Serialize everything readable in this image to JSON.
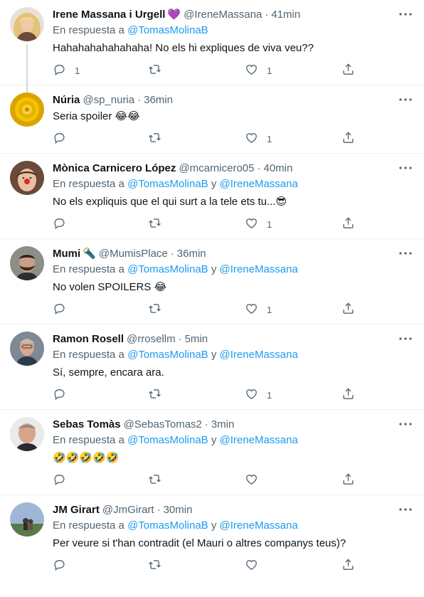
{
  "tweets": [
    {
      "name": "Irene Massana i Urgell",
      "badge": "💜",
      "handle": "@IreneMassana",
      "time": "41min",
      "reply_prefix": "En respuesta a",
      "mentions": [
        "@TomasMolinaB"
      ],
      "text": "Hahahahahahahaha! No els hi expliques de viva veu??",
      "replies": "1",
      "retweets": "",
      "likes": "1",
      "avatar": "irene"
    },
    {
      "name": "Núria",
      "badge": "",
      "handle": "@sp_nuria",
      "time": "36min",
      "reply_prefix": "",
      "mentions": [],
      "text": "Seria spoiler 😂😂",
      "replies": "",
      "retweets": "",
      "likes": "1",
      "avatar": "nuria"
    },
    {
      "name": "Mònica Carnicero López",
      "badge": "",
      "handle": "@mcarnicero05",
      "time": "40min",
      "reply_prefix": "En respuesta a",
      "mentions": [
        "@TomasMolinaB",
        "@IreneMassana"
      ],
      "text": "No els expliquis que el qui surt a la tele ets tu...😎",
      "replies": "",
      "retweets": "",
      "likes": "1",
      "avatar": "monica"
    },
    {
      "name": "Mumi",
      "badge": "🔦",
      "handle": "@MumisPlace",
      "time": "36min",
      "reply_prefix": "En respuesta a",
      "mentions": [
        "@TomasMolinaB",
        "@IreneMassana"
      ],
      "text": "No volen SPOILERS 😂",
      "replies": "",
      "retweets": "",
      "likes": "1",
      "avatar": "mumi"
    },
    {
      "name": "Ramon Rosell",
      "badge": "",
      "handle": "@rrosellm",
      "time": "5min",
      "reply_prefix": "En respuesta a",
      "mentions": [
        "@TomasMolinaB",
        "@IreneMassana"
      ],
      "text": "Sí, sempre, encara ara.",
      "replies": "",
      "retweets": "",
      "likes": "1",
      "avatar": "ramon"
    },
    {
      "name": "Sebas Tomàs",
      "badge": "",
      "handle": "@SebasTomas2",
      "time": "3min",
      "reply_prefix": "En respuesta a",
      "mentions": [
        "@TomasMolinaB",
        "@IreneMassana"
      ],
      "text": "🤣🤣🤣🤣🤣",
      "replies": "",
      "retweets": "",
      "likes": "",
      "avatar": "sebas"
    },
    {
      "name": "JM Girart",
      "badge": "",
      "handle": "@JmGirart",
      "time": "30min",
      "reply_prefix": "En respuesta a",
      "mentions": [
        "@TomasMolinaB",
        "@IreneMassana"
      ],
      "text": "Per veure si t'han contradit (el Mauri o altres companys teus)?",
      "replies": "",
      "retweets": "",
      "likes": "",
      "avatar": "jm"
    }
  ],
  "labels": {
    "mention_joiner": "y",
    "dot": "·"
  },
  "colors": {
    "link": "#1d9bf0",
    "muted": "#536471",
    "divider": "#eff3f4"
  },
  "icons": [
    "reply-icon",
    "retweet-icon",
    "like-icon",
    "share-icon",
    "more-icon"
  ]
}
